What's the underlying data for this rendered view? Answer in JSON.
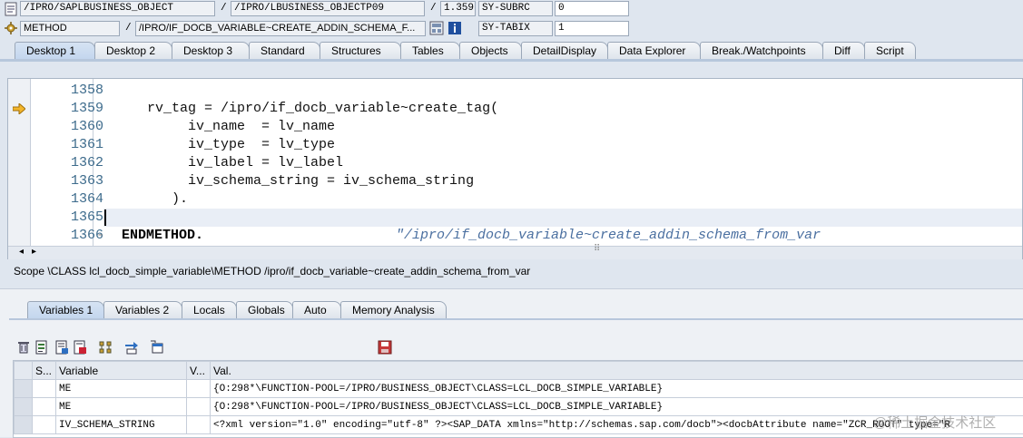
{
  "header": {
    "row1": {
      "program": "/IPRO/SAPLBUSINESS_OBJECT",
      "include": "/IPRO/LBUSINESS_OBJECTP09",
      "line": "1.359",
      "sysvar": "SY-SUBRC",
      "sysval": "0"
    },
    "row2": {
      "type": "METHOD",
      "name": "/IPRO/IF_DOCB_VARIABLE~CREATE_ADDIN_SCHEMA_F...",
      "sysvar": "SY-TABIX",
      "sysval": "1"
    },
    "slash": "/"
  },
  "desktop_tabs": [
    "Desktop 1",
    "Desktop 2",
    "Desktop 3",
    "Standard",
    "Structures",
    "Tables",
    "Objects",
    "DetailDisplay",
    "Data Explorer",
    "Break./Watchpoints",
    "Diff",
    "Script"
  ],
  "code": {
    "current_line": "1359",
    "lines": [
      {
        "num": "1358",
        "text": ""
      },
      {
        "num": "1359",
        "text": "    rv_tag = /ipro/if_docb_variable~create_tag("
      },
      {
        "num": "1360",
        "text": "         iv_name  = lv_name"
      },
      {
        "num": "1361",
        "text": "         iv_type  = lv_type"
      },
      {
        "num": "1362",
        "text": "         iv_label = lv_label"
      },
      {
        "num": "1363",
        "text": "         iv_schema_string = iv_schema_string"
      },
      {
        "num": "1364",
        "text": "       )."
      },
      {
        "num": "1365",
        "text": ""
      },
      {
        "num": "1366",
        "kw": "ENDMETHOD.",
        "comment": "\"/ipro/if_docb_variable~create_addin_schema_from_var"
      }
    ]
  },
  "scope": "Scope \\CLASS lcl_docb_simple_variable\\METHOD /ipro/if_docb_variable~create_addin_schema_from_var",
  "var_tabs": [
    "Variables 1",
    "Variables 2",
    "Locals",
    "Globals",
    "Auto",
    "Memory Analysis"
  ],
  "table": {
    "headers": [
      "S...",
      "Variable",
      "V...",
      "Val."
    ],
    "rows": [
      {
        "variable": "ME",
        "value": "{O:298*\\FUNCTION-POOL=/IPRO/BUSINESS_OBJECT\\CLASS=LCL_DOCB_SIMPLE_VARIABLE}"
      },
      {
        "variable": "ME",
        "value": "{O:298*\\FUNCTION-POOL=/IPRO/BUSINESS_OBJECT\\CLASS=LCL_DOCB_SIMPLE_VARIABLE}"
      },
      {
        "variable": "IV_SCHEMA_STRING",
        "value": "<?xml version=\"1.0\" encoding=\"utf-8\" ?><SAP_DATA xmlns=\"http://schemas.sap.com/docb\"><docbAttribute name=\"ZCR_ROOT\" type=\"R"
      }
    ]
  },
  "watermark": "@稀土掘金技术社区",
  "colors": {
    "background": "#dfe6ef",
    "active_tab": "#c4d6ee",
    "line_numbers": "#3d6b8c",
    "current_line_highlight": "#e9eef6"
  }
}
